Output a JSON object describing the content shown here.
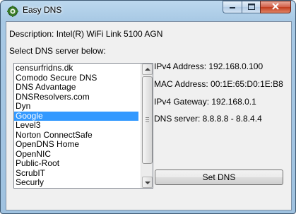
{
  "window": {
    "title": "Easy DNS",
    "app_icon": "gear-icon",
    "caption_buttons": {
      "minimize": "minimize-icon",
      "maximize": "maximize-icon",
      "close": "close-icon"
    }
  },
  "description": "Description: Intel(R) WiFi Link 5100 AGN",
  "select_label": "Select DNS server below:",
  "dns_servers": [
    "censurfridns.dk",
    "Comodo Secure DNS",
    "DNS Advantage",
    "DNSResolvers.com",
    "Dyn",
    "Google",
    "Level3",
    "Norton ConnectSafe",
    "OpenDNS Home",
    "OpenNIC",
    "Public-Root",
    "ScrubIT",
    "Securly"
  ],
  "selected_server": "Google",
  "info": {
    "ipv4": "IPv4 Address: 192.168.0.100",
    "mac": "MAC Address: 00:1E:65:D0:1E:B8",
    "gateway": "IPv4 Gateway: 192.168.0.1",
    "dns": "DNS server: 8.8.8.8 - 8.8.4.4"
  },
  "set_button": "Set DNS"
}
